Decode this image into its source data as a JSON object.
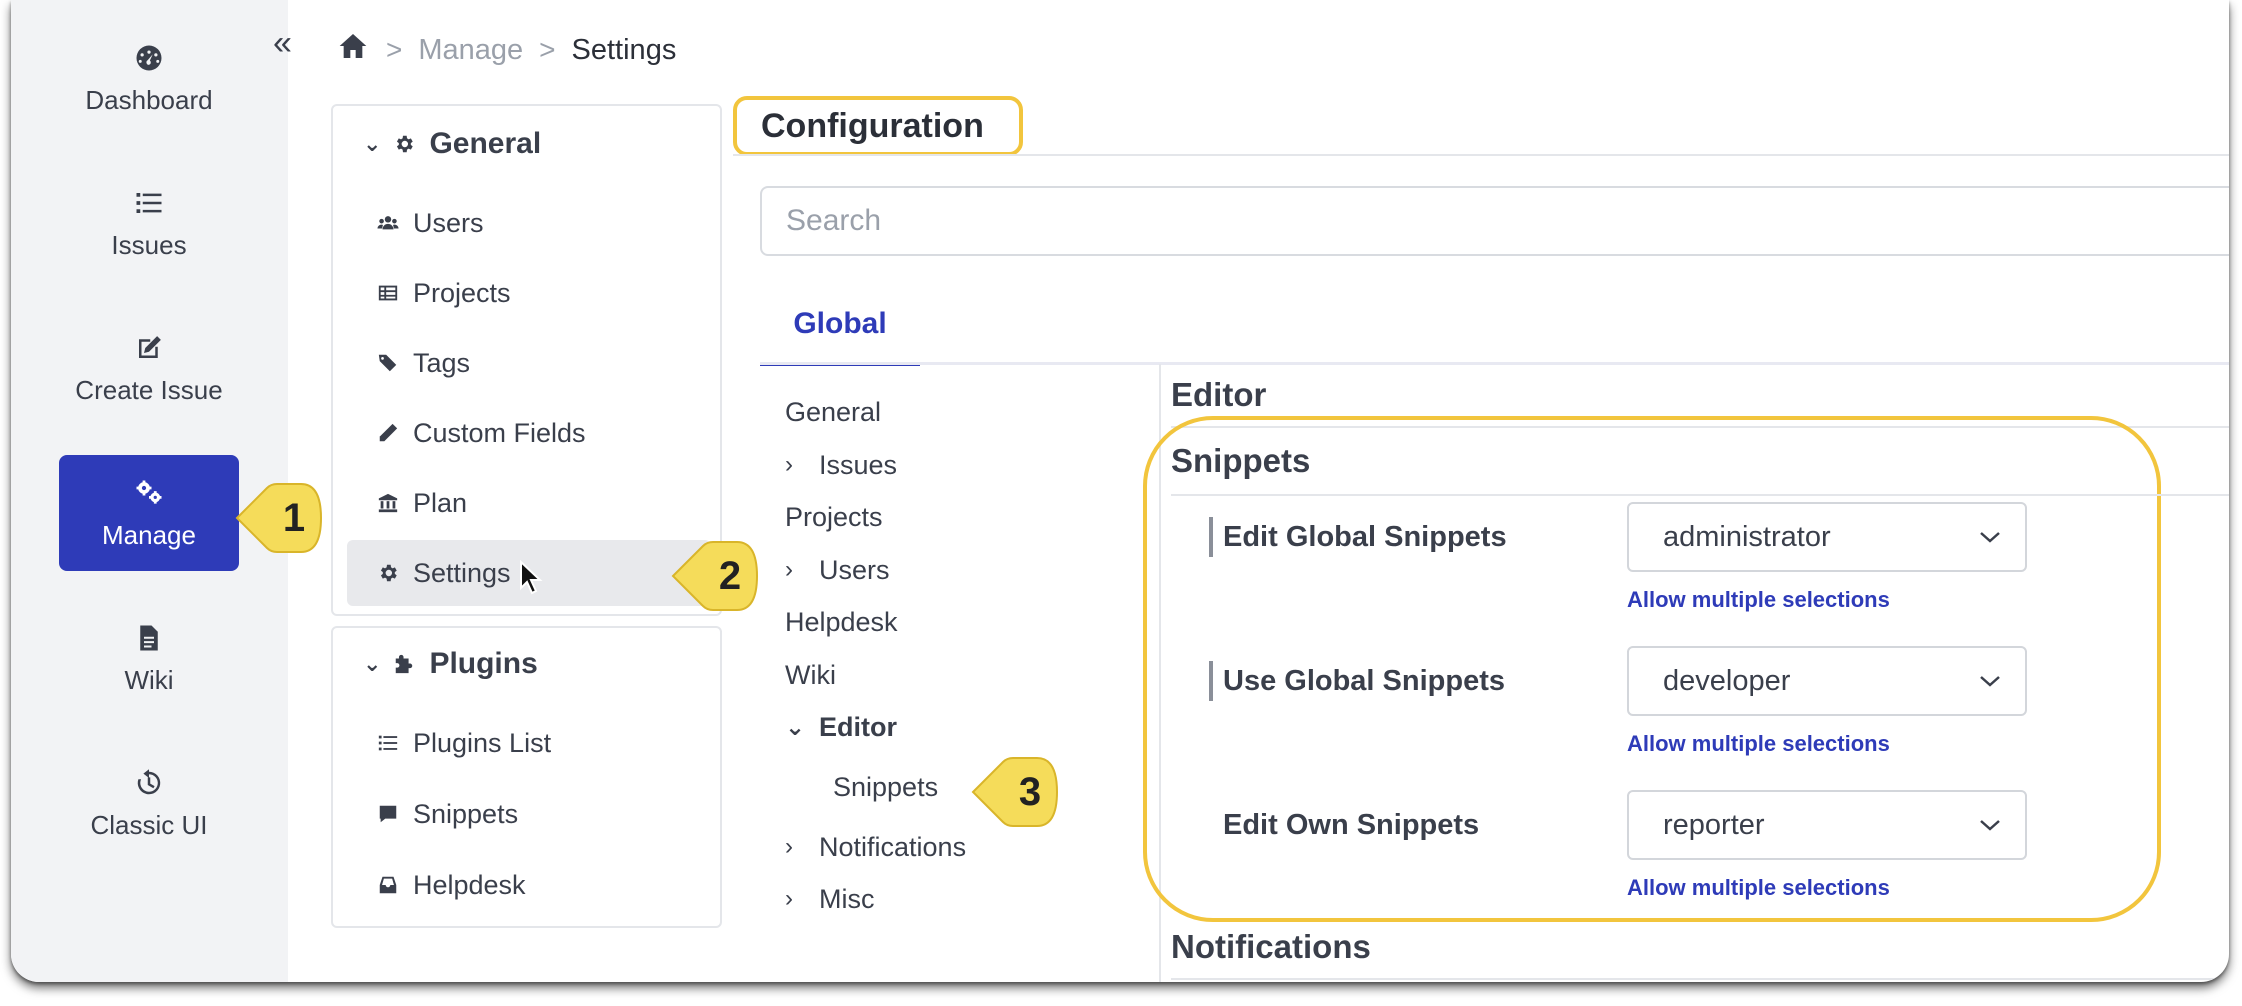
{
  "rail": {
    "items": [
      {
        "label": "Dashboard",
        "icon": "dashboard-gauge-icon"
      },
      {
        "label": "Issues",
        "icon": "list-icon"
      },
      {
        "label": "Create Issue",
        "icon": "edit-icon"
      },
      {
        "label": "Manage",
        "icon": "cogs-icon",
        "active": true
      },
      {
        "label": "Wiki",
        "icon": "document-icon"
      },
      {
        "label": "Classic UI",
        "icon": "history-icon"
      }
    ],
    "collapse_glyph": "«"
  },
  "breadcrumb": {
    "items": [
      "Manage",
      "Settings"
    ],
    "separator": ">"
  },
  "panels": {
    "general": {
      "title": "General",
      "items": [
        "Users",
        "Projects",
        "Tags",
        "Custom Fields",
        "Plan",
        "Settings"
      ],
      "selected": "Settings"
    },
    "plugins": {
      "title": "Plugins",
      "items": [
        "Plugins List",
        "Snippets",
        "Helpdesk"
      ]
    }
  },
  "callouts": [
    "1",
    "2",
    "3"
  ],
  "config": {
    "title": "Configuration",
    "search_placeholder": "Search",
    "tab": "Global",
    "tree": [
      "General",
      "Issues",
      "Projects",
      "Users",
      "Helpdesk",
      "Wiki",
      "Editor",
      "Snippets",
      "Notifications",
      "Misc"
    ]
  },
  "content": {
    "editor_title": "Editor",
    "snippets_title": "Snippets",
    "notifications_title": "Notifications",
    "settings": [
      {
        "label": "Edit Global Snippets",
        "value": "administrator",
        "hint": "Allow multiple selections"
      },
      {
        "label": "Use Global Snippets",
        "value": "developer",
        "hint": "Allow multiple selections"
      },
      {
        "label": "Edit Own Snippets",
        "value": "reporter",
        "hint": "Allow multiple selections"
      }
    ]
  },
  "colors": {
    "accent": "#2e3bb8",
    "highlight": "#f2c53d",
    "callout_fill": "#f5dc5a",
    "rail_bg": "#f2f3f5"
  }
}
